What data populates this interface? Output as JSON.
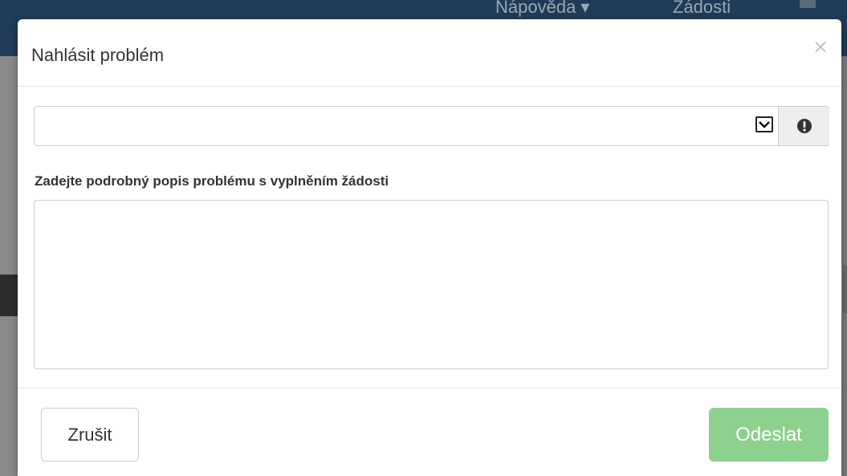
{
  "background": {
    "nav_help": "Nápověda ▾",
    "nav_requests": "Žádosti"
  },
  "modal": {
    "title": "Nahlásit problém",
    "close_glyph": "×",
    "select_value": "",
    "description_label": "Zadejte podrobný popis problému s vyplněním žádosti",
    "description_value": "",
    "cancel_label": "Zrušit",
    "submit_label": "Odeslat"
  },
  "icons": {
    "select_arrow": "chevron-down-icon",
    "info": "exclamation-circle-icon",
    "close": "close-icon"
  },
  "colors": {
    "navbar": "#1f3b57",
    "submit_disabled": "#8ed08e"
  }
}
